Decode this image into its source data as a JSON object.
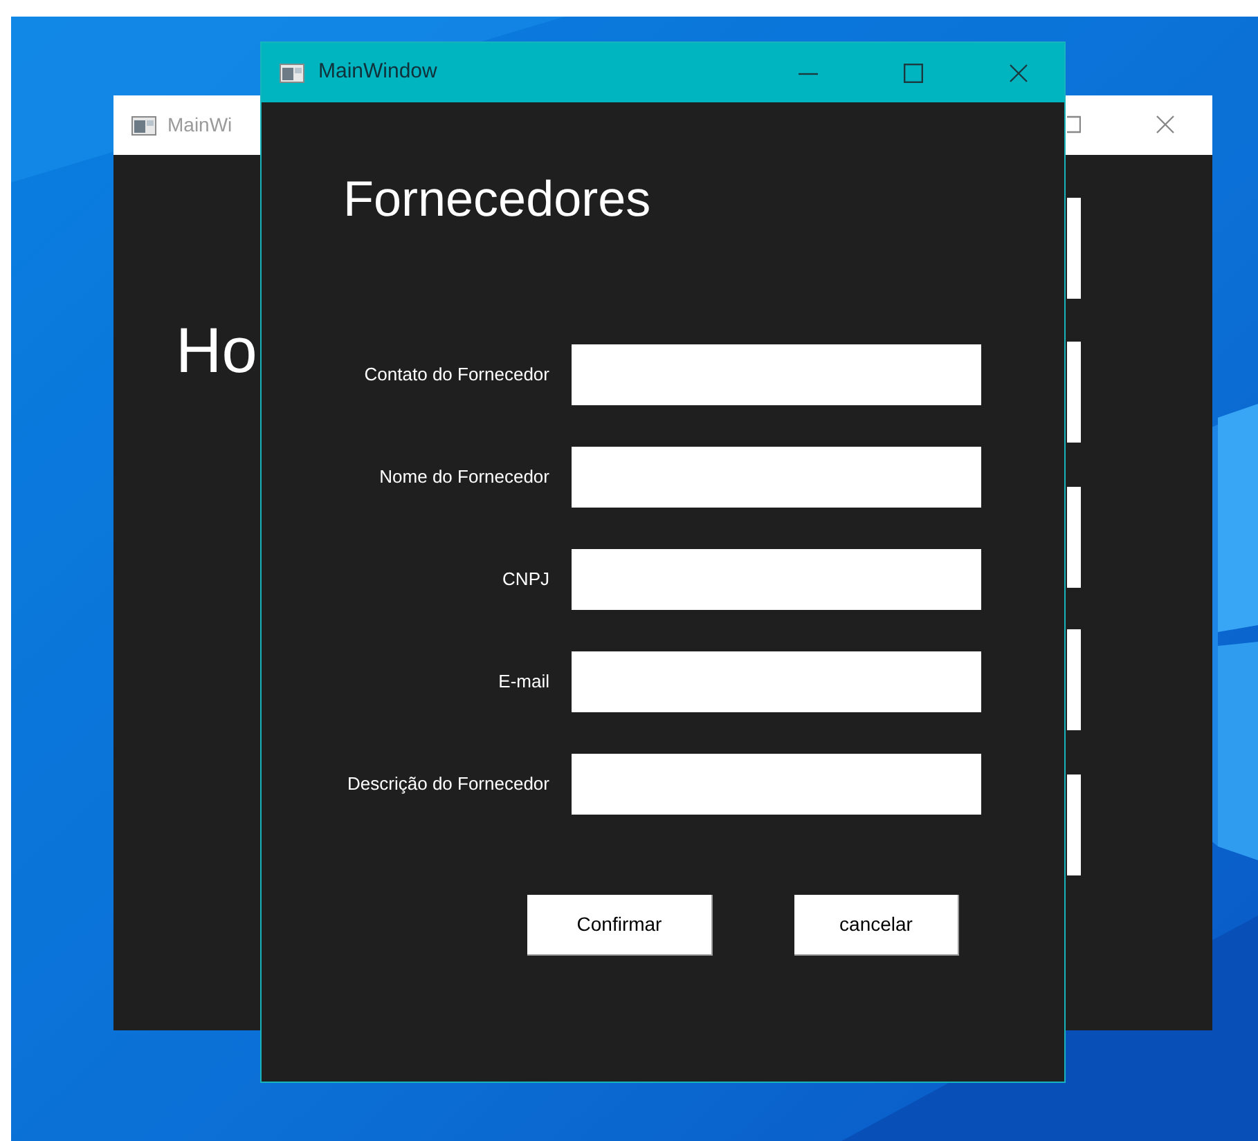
{
  "back_window": {
    "title": "MainWi",
    "heading": "Ho"
  },
  "window": {
    "title": "MainWindow",
    "heading": "Fornecedores",
    "fields": [
      {
        "label": "Contato do Fornecedor"
      },
      {
        "label": "Nome do Fornecedor"
      },
      {
        "label": "CNPJ"
      },
      {
        "label": "E-mail"
      },
      {
        "label": "Descrição do Fornecedor"
      }
    ],
    "buttons": [
      {
        "label": "Confirmar"
      },
      {
        "label": "cancelar"
      }
    ]
  }
}
